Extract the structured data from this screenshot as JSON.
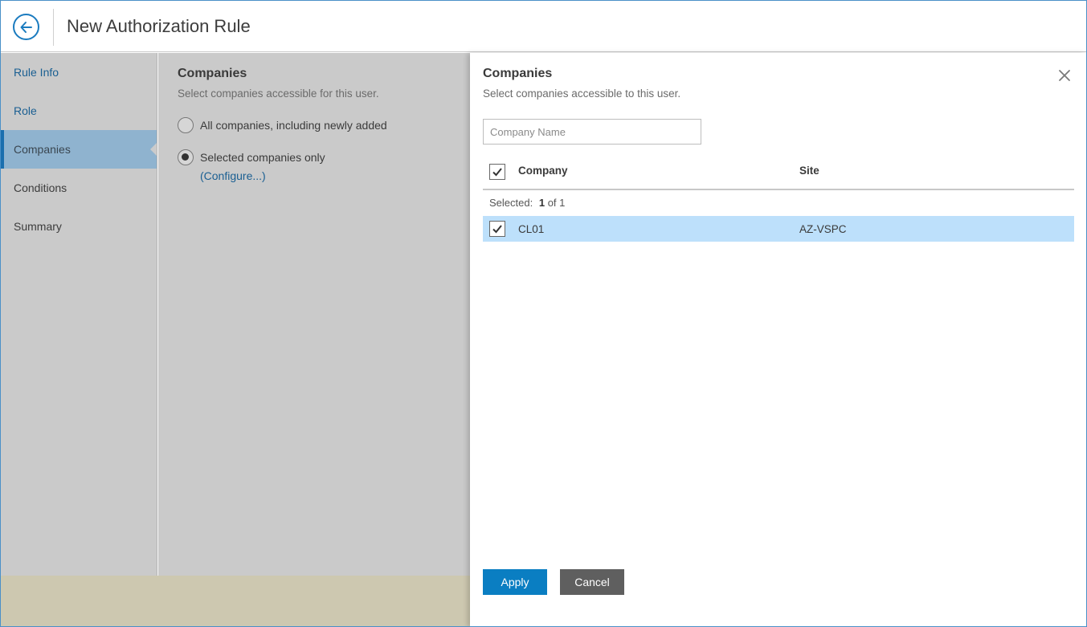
{
  "header": {
    "title": "New Authorization Rule"
  },
  "sidebar": {
    "items": [
      {
        "label": "Rule Info"
      },
      {
        "label": "Role"
      },
      {
        "label": "Companies"
      },
      {
        "label": "Conditions"
      },
      {
        "label": "Summary"
      }
    ]
  },
  "step": {
    "title": "Companies",
    "subtitle": "Select companies accessible for this user.",
    "option_all": "All companies, including newly added",
    "option_selected": "Selected companies only",
    "selected_option": "Selected companies only",
    "configure_link": "(Configure...)"
  },
  "panel": {
    "title": "Companies",
    "subtitle": "Select companies accessible to this user.",
    "search": {
      "placeholder": "Company Name",
      "value": ""
    },
    "columns": {
      "company": "Company",
      "site": "Site"
    },
    "selection": {
      "label": "Selected:",
      "count": "1",
      "total_text": "of 1"
    },
    "rows": [
      {
        "company": "CL01",
        "site": "AZ-VSPC",
        "checked": true
      }
    ],
    "apply_label": "Apply",
    "cancel_label": "Cancel"
  },
  "colors": {
    "accent": "#0a7ec2",
    "selected_row": "#bde0fb",
    "nav_active": "#8fb3cf"
  }
}
